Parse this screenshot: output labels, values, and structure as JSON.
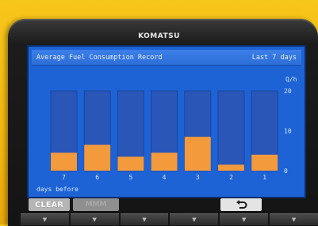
{
  "header": {
    "brand": "KOMATSU"
  },
  "screen": {
    "title": "Average Fuel Consumption Record",
    "period": "Last 7 days",
    "footer": "days before"
  },
  "chart_data": {
    "type": "bar",
    "categories": [
      "7",
      "6",
      "5",
      "4",
      "3",
      "2",
      "1"
    ],
    "values": [
      4.5,
      6.5,
      3.5,
      4.5,
      8.5,
      1.5,
      4.0
    ],
    "ylim": [
      0,
      20
    ],
    "yticks": [
      "0",
      "10",
      "20"
    ],
    "ylabel": "Q/h",
    "xlabel": "days before",
    "bar_color": "#f39a3c",
    "bar_bg_color": "#2a56b8",
    "grid": false
  },
  "softkeys": {
    "clear": "CLEAR",
    "dim": "MMM",
    "back_icon": "return-arrow-icon"
  },
  "colors": {
    "screen_bg": "#1d63d6",
    "bar": "#f39a3c",
    "housing": "#f2b810"
  }
}
